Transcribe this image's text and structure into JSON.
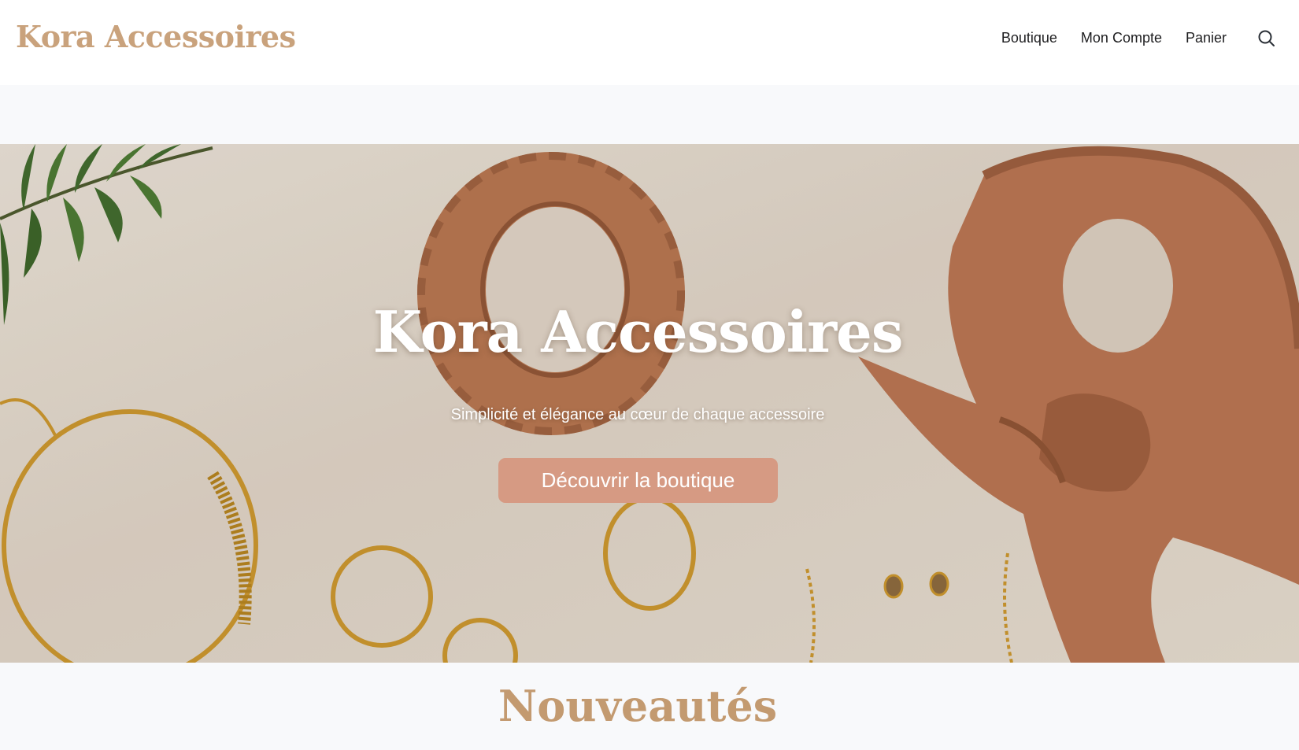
{
  "header": {
    "brand": "Kora Accessoires",
    "nav": [
      {
        "label": "Boutique"
      },
      {
        "label": "Mon Compte"
      },
      {
        "label": "Panier"
      }
    ],
    "search_icon": "search-icon"
  },
  "hero": {
    "title": "Kora Accessoires",
    "subtitle": "Simplicité et élégance au cœur de chaque accessoire",
    "cta_label": "Découvrir la boutique",
    "image_subject": "hero-product-photo"
  },
  "new_arrivals": {
    "title": "Nouveautés"
  },
  "colors": {
    "brand": "#c9a27c",
    "cta": "#d69a83",
    "section_title": "#c39a70",
    "nav_text": "#1d1d1f"
  }
}
